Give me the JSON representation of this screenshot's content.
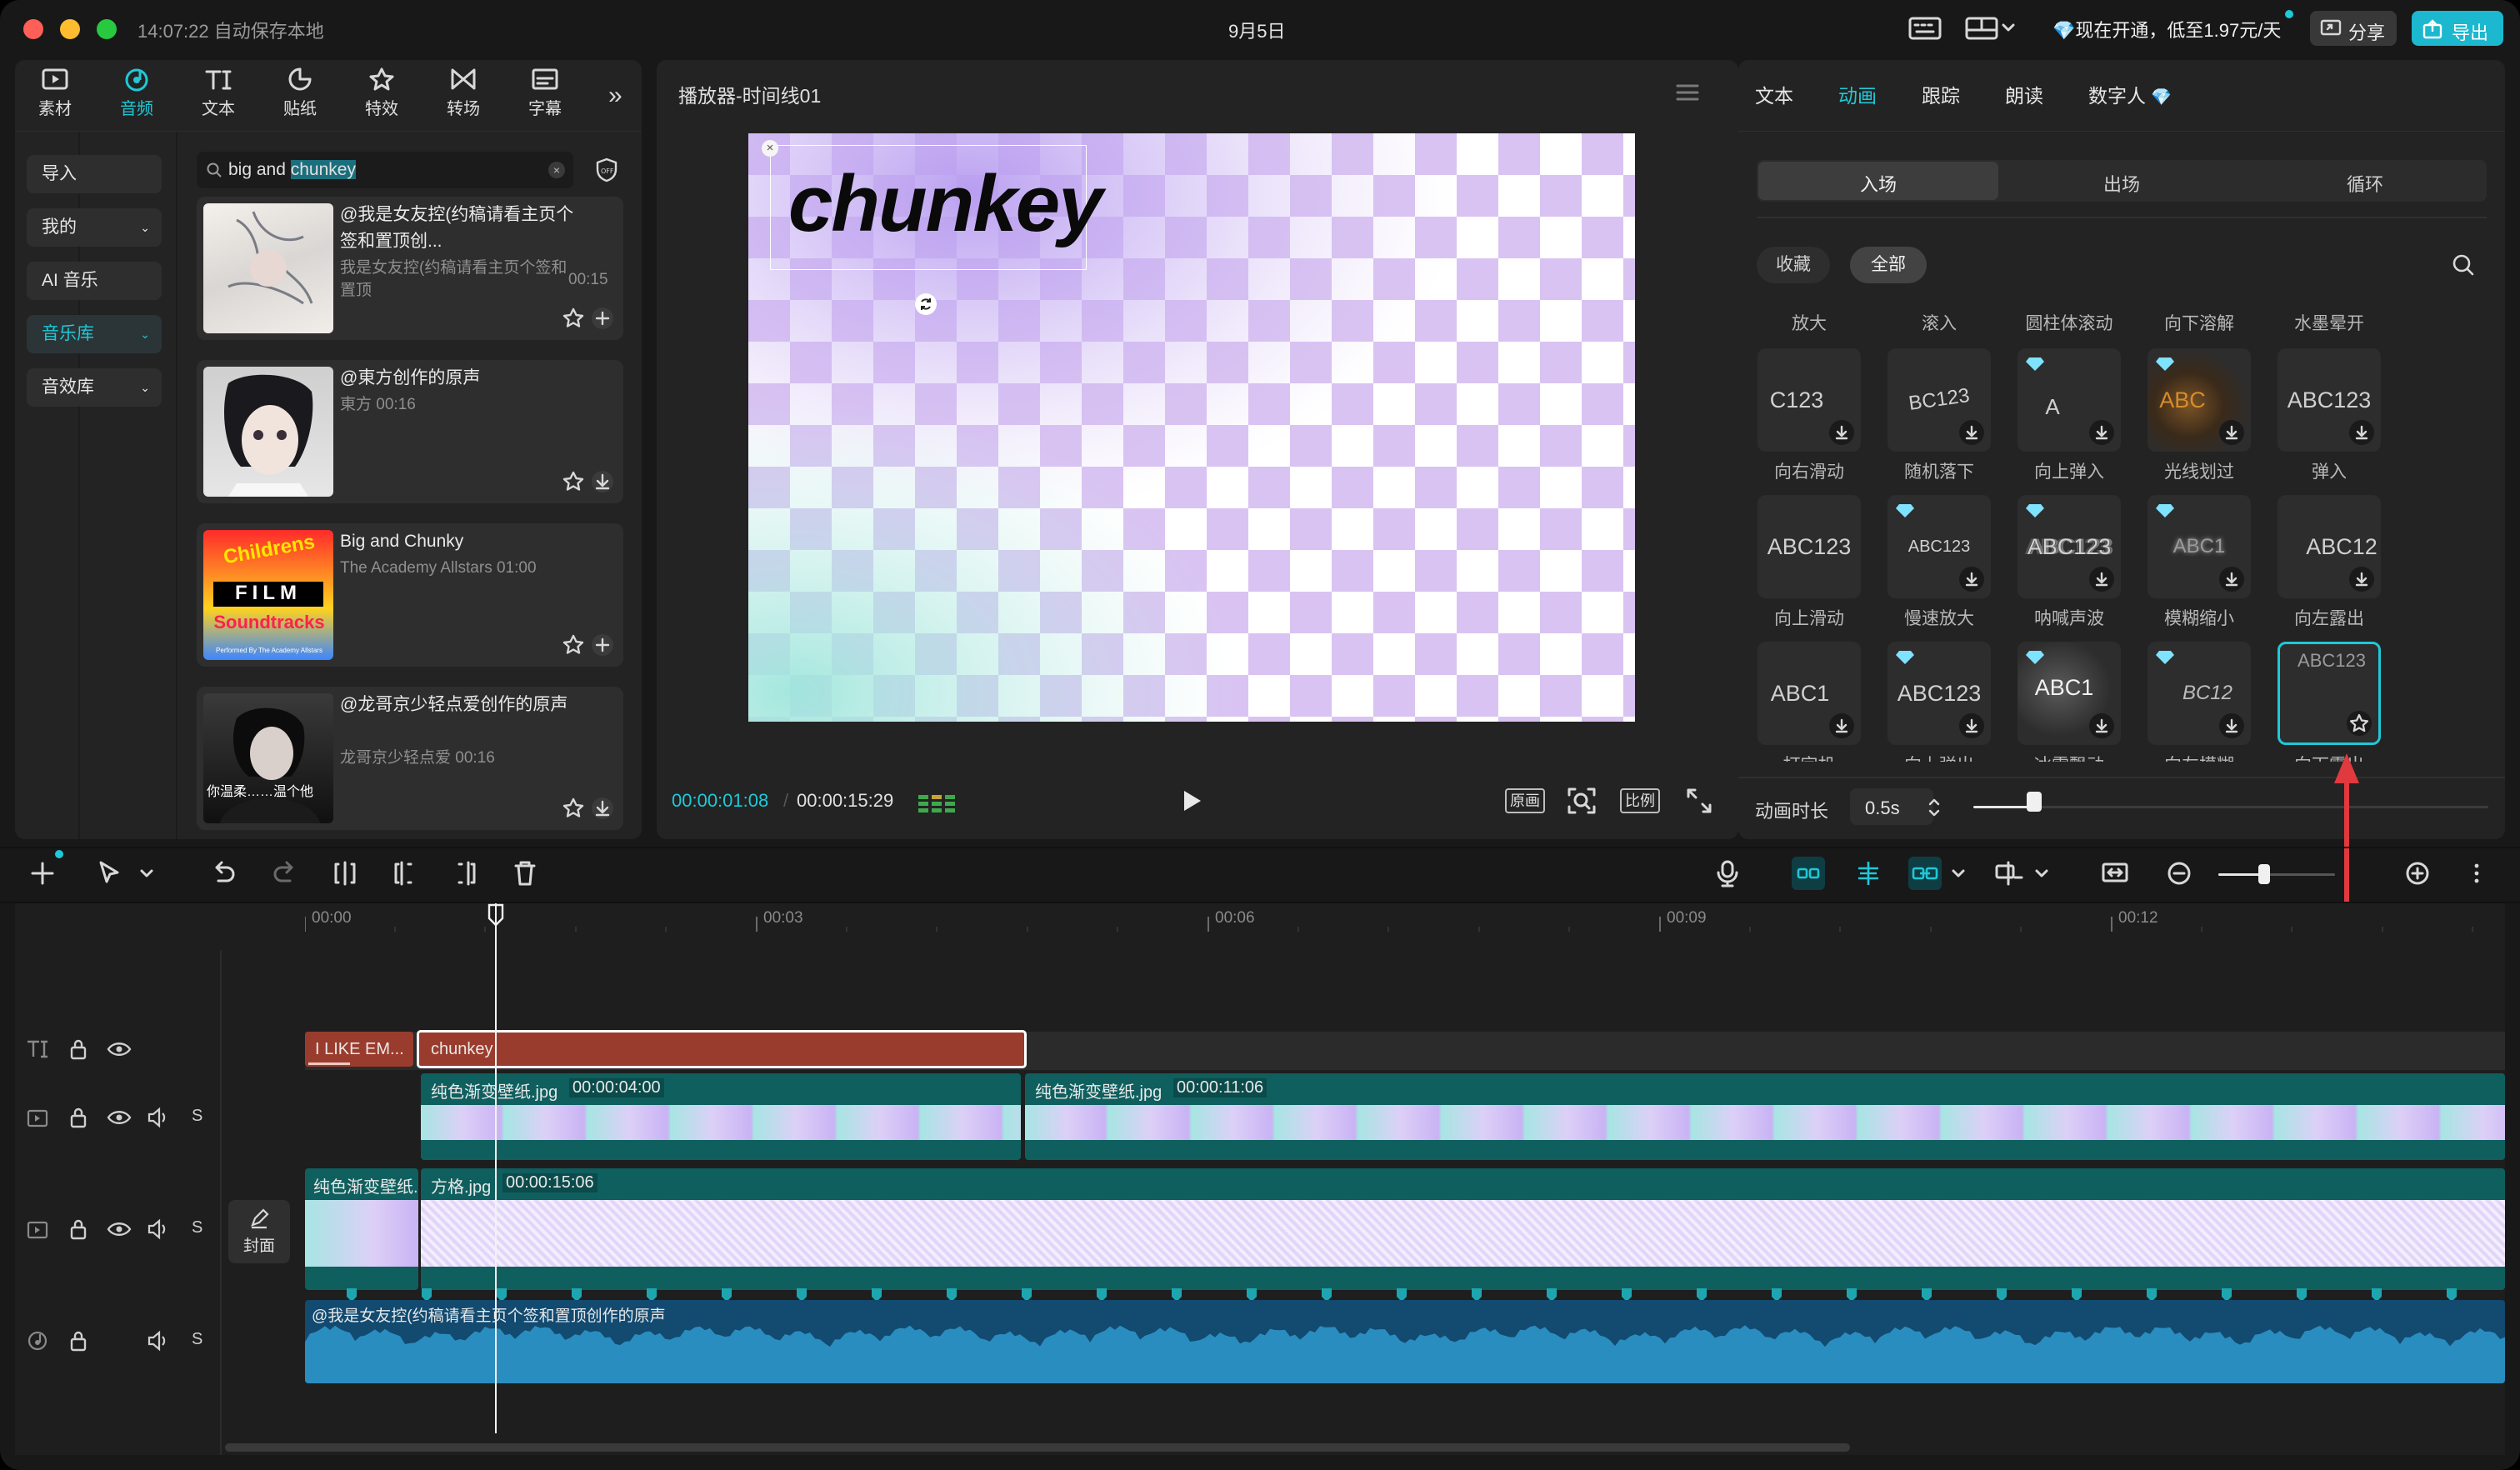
{
  "titlebar": {
    "autosave": "14:07:22 自动保存本地",
    "project_title": "9月5日",
    "promo": "现在开通，低至1.97元/天",
    "share": "分享",
    "export": "导出"
  },
  "toolbar_tabs": [
    {
      "label": "素材",
      "icon": "media-icon"
    },
    {
      "label": "音频",
      "icon": "audio-icon",
      "active": true
    },
    {
      "label": "文本",
      "icon": "text-icon"
    },
    {
      "label": "贴纸",
      "icon": "sticker-icon"
    },
    {
      "label": "特效",
      "icon": "effects-icon"
    },
    {
      "label": "转场",
      "icon": "transition-icon"
    },
    {
      "label": "字幕",
      "icon": "caption-icon"
    }
  ],
  "sidebar": {
    "items": [
      "导入",
      "我的",
      "AI 音乐",
      "音乐库",
      "音效库"
    ]
  },
  "search": {
    "query_prefix": "big and ",
    "query_selected": "chunkey"
  },
  "music_list": [
    {
      "title": "@我是女友控(约稿请看主页个签和置顶创...",
      "subtitle": "我是女友控(约稿请看主页个签和置顶",
      "duration": "00:15"
    },
    {
      "title": "@東方创作的原声",
      "subtitle": "東方 00:16",
      "duration": ""
    },
    {
      "title": "Big and Chunky",
      "subtitle": "The Academy Allstars 01:00",
      "duration": ""
    },
    {
      "title": "@龙哥京少轻点爱创作的原声",
      "subtitle": "龙哥京少轻点爱 00:16",
      "duration": ""
    }
  ],
  "thumb_text": {
    "film_top": "Childrens",
    "film_mid": "FILM",
    "film_bottom": "Soundtracks",
    "film_credit": "Performed By The Academy Allstars",
    "person_caption": "你温柔……温个他"
  },
  "player": {
    "title": "播放器-时间线01",
    "overlay_text": "chunkey",
    "current_time": "00:00:01:08",
    "total_time": "00:00:15:29",
    "btn_original": "原画",
    "btn_ratio": "比例"
  },
  "right_panel": {
    "tabs": [
      "文本",
      "动画",
      "跟踪",
      "朗读",
      "数字人"
    ],
    "active_tab": "动画",
    "subtabs": [
      "入场",
      "出场",
      "循环"
    ],
    "filters": [
      "收藏",
      "全部"
    ],
    "row0_names": [
      "放大",
      "滚入",
      "圆柱体滚动",
      "向下溶解",
      "水墨晕开"
    ],
    "grid": [
      [
        {
          "text": "C123",
          "name": "向右滑动"
        },
        {
          "text": "BC123",
          "name": "随机落下"
        },
        {
          "text": "A",
          "name": "向上弹入"
        },
        {
          "text": "ABC",
          "name": "光线划过"
        },
        {
          "text": "ABC123",
          "name": "弹入"
        }
      ],
      [
        {
          "text": "ABC123",
          "name": "向上滑动"
        },
        {
          "text": "ABC123",
          "name": "慢速放大"
        },
        {
          "text": "ABC123",
          "name": "呐喊声波"
        },
        {
          "text": "ABC1",
          "name": "模糊缩小"
        },
        {
          "text": "ABC12",
          "name": "向左露出"
        }
      ],
      [
        {
          "text": "ABC1",
          "name": "打字机"
        },
        {
          "text": "ABC123",
          "name": "向上弹出"
        },
        {
          "text": "ABC1",
          "name": "冰雪飘动"
        },
        {
          "text": "BC12",
          "name": "向左模糊"
        },
        {
          "text": "ABC123",
          "name": "向下露出"
        }
      ]
    ],
    "duration_label": "动画时长",
    "duration_value": "0.5s"
  },
  "timeline": {
    "ruler": [
      "00:00",
      "00:03",
      "00:06",
      "00:09",
      "00:12"
    ],
    "text_clips": [
      "I LIKE EM...",
      "chunkey"
    ],
    "video_clips": [
      {
        "name": "纯色渐变壁纸.jpg",
        "duration": "00:00:04:00"
      },
      {
        "name": "纯色渐变壁纸.jpg",
        "duration": "00:00:11:06"
      }
    ],
    "main_clips": [
      {
        "name": "纯色渐变壁纸.",
        "duration": ""
      },
      {
        "name": "方格.jpg",
        "duration": "00:00:15:06"
      }
    ],
    "cover_label": "封面",
    "audio_clip": "@我是女友控(约稿请看主页个签和置顶创作的原声"
  },
  "colors": {
    "accent": "#1ec9d8",
    "text_clip": "#9a3c2d",
    "video_clip": "#0f5f5f",
    "audio_clip": "#1c6f9c",
    "marker": "#1ea6b0",
    "arrow": "#e0393e"
  }
}
